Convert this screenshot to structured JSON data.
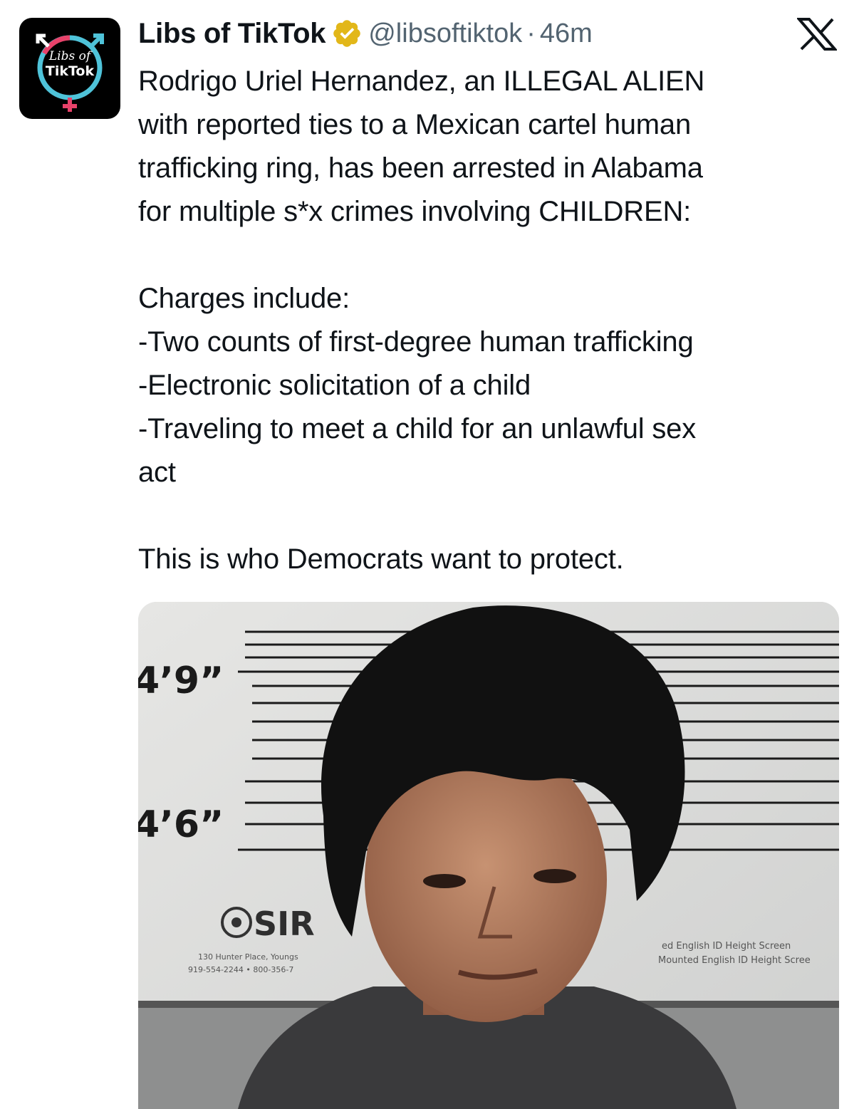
{
  "author": {
    "avatar_text_line1": "Libs of",
    "avatar_text_line2": "TikTok",
    "display_name": "Libs of TikTok",
    "verified_icon": "verified-badge-gold",
    "handle": "@libsoftiktok",
    "separator": "·",
    "time": "46m"
  },
  "platform_icon": "x-logo",
  "tweet": {
    "paragraph1": [
      "Rodrigo Uriel Hernandez, an ILLEGAL ALIEN",
      "with reported ties to a Mexican cartel human",
      "trafficking ring, has been arrested in Alabama",
      "for multiple s*x crimes involving CHILDREN:"
    ],
    "charges": [
      "Charges include:",
      "-Two counts of first-degree human trafficking",
      "-Electronic solicitation of a child",
      "-Traveling to meet a child for an unlawful sex",
      "act"
    ],
    "closing": "This is who Democrats want to protect."
  },
  "media": {
    "alt": "mugshot",
    "height_marks": [
      "4’9”",
      "4’6”"
    ],
    "sign_text": "SIR",
    "sign_small_line1": "130 Hunter Place, Youngs",
    "sign_small_line2": "919-554-2244 • 800-356-7",
    "right_small_line1": "ed English ID Height Screen",
    "right_small_line2": "Mounted English ID Height Scree"
  },
  "colors": {
    "verified_gold": "#e2b719",
    "text_primary": "#0f1419",
    "text_secondary": "#536471"
  }
}
